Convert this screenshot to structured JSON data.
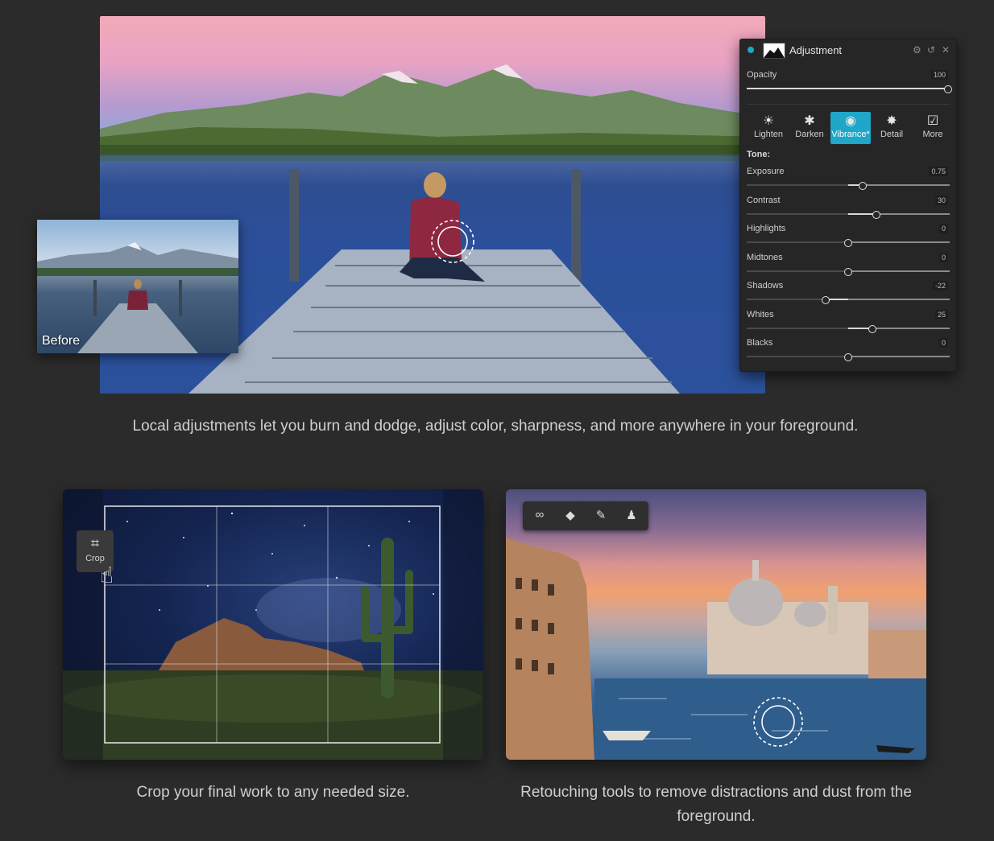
{
  "before_label": "Before",
  "panel": {
    "title": "Adjustment",
    "opacity": {
      "label": "Opacity",
      "value": "100",
      "level": 1.0
    },
    "tools": [
      {
        "label": "Lighten",
        "icon": "sun-icon",
        "glyph": "☀",
        "active": false
      },
      {
        "label": "Darken",
        "icon": "darken-icon",
        "glyph": "✱",
        "active": false
      },
      {
        "label": "Vibrance*",
        "icon": "color-wheel-icon",
        "glyph": "◉",
        "active": true
      },
      {
        "label": "Detail",
        "icon": "detail-icon",
        "glyph": "✸",
        "active": false
      },
      {
        "label": "More",
        "icon": "more-checkbox-icon",
        "glyph": "☑",
        "active": false
      }
    ],
    "tone_label": "Tone:",
    "sliders": [
      {
        "label": "Exposure",
        "value": "0.75",
        "level": 0.57
      },
      {
        "label": "Contrast",
        "value": "30",
        "level": 0.64
      },
      {
        "label": "Highlights",
        "value": "0",
        "level": 0.5
      },
      {
        "label": "Midtones",
        "value": "0",
        "level": 0.5
      },
      {
        "label": "Shadows",
        "value": "-22",
        "level": 0.39
      },
      {
        "label": "Whites",
        "value": "25",
        "level": 0.62
      },
      {
        "label": "Blacks",
        "value": "0",
        "level": 0.5
      }
    ],
    "accent": "#1fa6c8"
  },
  "captions": {
    "local": "Local adjustments let you burn and dodge, adjust color, sharpness, and more anywhere in your foreground.",
    "crop": "Crop your final work to any needed size.",
    "retouch": "Retouching tools to remove distractions and dust from the foreground."
  },
  "crop": {
    "button_label": "Crop"
  },
  "retouch_tools": [
    "link-icon",
    "eraser-icon",
    "brush-icon",
    "stamp-icon"
  ]
}
